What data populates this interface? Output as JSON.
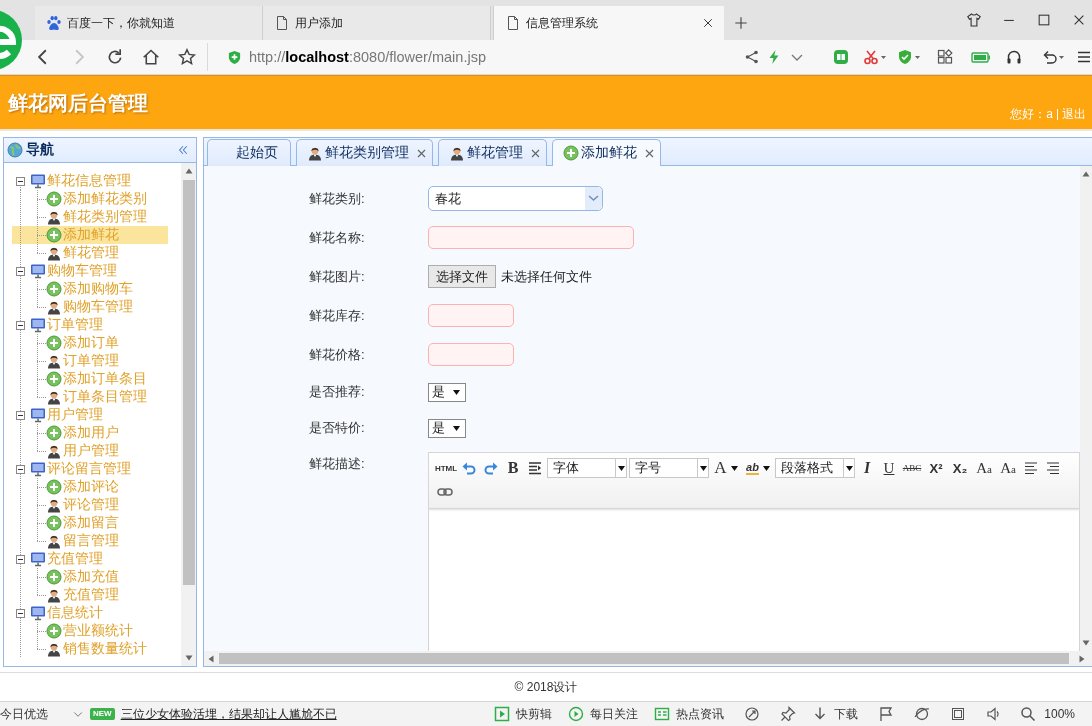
{
  "browser": {
    "tabs": [
      {
        "title": "百度一下，你就知道",
        "kind": "baidu",
        "selected": false
      },
      {
        "title": "用户添加",
        "kind": "page",
        "selected": false
      },
      {
        "title": "信息管理系统",
        "kind": "page",
        "selected": true
      }
    ],
    "nav_buttons": [
      {
        "kind": "back",
        "disabled": false
      },
      {
        "kind": "forward",
        "disabled": true
      },
      {
        "kind": "reload",
        "disabled": false
      },
      {
        "kind": "home",
        "disabled": false
      },
      {
        "kind": "bookmark",
        "disabled": false
      }
    ],
    "url": "http://**localhost**:8080/flower/main.jsp"
  },
  "header": {
    "title": "鲜花网后台管理",
    "greeting": "您好：a",
    "logout": "退出"
  },
  "sidebar": {
    "title": "导航",
    "groups": [
      {
        "label": "鲜花信息管理",
        "expanded": true,
        "selected": false,
        "children": [
          {
            "label": "添加鲜花类别",
            "kind": "add",
            "selected": false
          },
          {
            "label": "鲜花类别管理",
            "kind": "manage",
            "selected": false
          },
          {
            "label": "添加鲜花",
            "kind": "add",
            "selected": true
          },
          {
            "label": "鲜花管理",
            "kind": "manage",
            "selected": false
          }
        ]
      },
      {
        "label": "购物车管理",
        "expanded": true,
        "selected": false,
        "children": [
          {
            "label": "添加购物车",
            "kind": "add",
            "selected": false
          },
          {
            "label": "购物车管理",
            "kind": "manage",
            "selected": false
          }
        ]
      },
      {
        "label": "订单管理",
        "expanded": true,
        "selected": false,
        "children": [
          {
            "label": "添加订单",
            "kind": "add",
            "selected": false
          },
          {
            "label": "订单管理",
            "kind": "manage",
            "selected": false
          },
          {
            "label": "添加订单条目",
            "kind": "add",
            "selected": false
          },
          {
            "label": "订单条目管理",
            "kind": "manage",
            "selected": false
          }
        ]
      },
      {
        "label": "用户管理",
        "expanded": true,
        "selected": false,
        "children": [
          {
            "label": "添加用户",
            "kind": "add",
            "selected": false
          },
          {
            "label": "用户管理",
            "kind": "manage",
            "selected": false
          }
        ]
      },
      {
        "label": "评论留言管理",
        "expanded": true,
        "selected": false,
        "children": [
          {
            "label": "添加评论",
            "kind": "add",
            "selected": false
          },
          {
            "label": "评论管理",
            "kind": "manage",
            "selected": false
          },
          {
            "label": "添加留言",
            "kind": "add",
            "selected": false
          },
          {
            "label": "留言管理",
            "kind": "manage",
            "selected": false
          }
        ]
      },
      {
        "label": "充值管理",
        "expanded": true,
        "selected": false,
        "children": [
          {
            "label": "添加充值",
            "kind": "add",
            "selected": false
          },
          {
            "label": "充值管理",
            "kind": "manage",
            "selected": false
          }
        ]
      },
      {
        "label": "信息统计",
        "expanded": true,
        "selected": false,
        "children": [
          {
            "label": "营业额统计",
            "kind": "add",
            "selected": false
          },
          {
            "label": "销售数量统计",
            "kind": "manage",
            "selected": false
          }
        ]
      }
    ]
  },
  "tabs": [
    {
      "label": "起始页",
      "kind": "home",
      "selected": false,
      "closable": false
    },
    {
      "label": "鲜花类别管理",
      "kind": "manage",
      "selected": false,
      "closable": true
    },
    {
      "label": "鲜花管理",
      "kind": "manage",
      "selected": false,
      "closable": true
    },
    {
      "label": "添加鲜花",
      "kind": "add",
      "selected": true,
      "closable": true
    }
  ],
  "form": {
    "fields": [
      {
        "label": "鲜花类别:",
        "kind": "combo",
        "value": "春花"
      },
      {
        "label": "鲜花名称:",
        "kind": "text",
        "invalid": true
      },
      {
        "label": "鲜花图片:",
        "kind": "file",
        "button": "选择文件",
        "value": "未选择任何文件"
      },
      {
        "label": "鲜花库存:",
        "kind": "number",
        "invalid": true
      },
      {
        "label": "鲜花价格:",
        "kind": "number",
        "invalid": true
      },
      {
        "label": "是否推荐:",
        "kind": "select",
        "value": "是"
      },
      {
        "label": "是否特价:",
        "kind": "select",
        "value": "是"
      },
      {
        "label": "鲜花描述:",
        "kind": "editor",
        "toolbar_rows": [
          [
            {
              "kind": "source",
              "label": "HTML"
            },
            {
              "kind": "undo"
            },
            {
              "kind": "redo"
            },
            {
              "kind": "bold",
              "label": "B"
            },
            {
              "kind": "indent"
            },
            {
              "kind": "dropdown",
              "label": "字体"
            },
            {
              "kind": "dropdown",
              "label": "字号"
            },
            {
              "kind": "forecolor",
              "label": "A"
            },
            {
              "kind": "highlight",
              "label": "ab"
            },
            {
              "kind": "dropdown",
              "label": "段落格式"
            },
            {
              "kind": "italic",
              "label": "I"
            },
            {
              "kind": "underline",
              "label": "U"
            },
            {
              "kind": "strike",
              "label": "ABC"
            },
            {
              "kind": "superscript",
              "label": "X²"
            },
            {
              "kind": "subscript",
              "label": "X₂"
            },
            {
              "kind": "case",
              "label": "Aa"
            },
            {
              "kind": "case",
              "label": "Aa"
            },
            {
              "kind": "alignleft"
            },
            {
              "kind": "alignright"
            }
          ],
          [
            {
              "kind": "link"
            }
          ]
        ]
      }
    ]
  },
  "footer": {
    "text": "© 2018设计"
  },
  "status_bar": {
    "label": "今日优选",
    "badge": "NEW",
    "headline": "三位少女体验活埋，结果却让人尴尬不已",
    "items": [
      {
        "kind": "clip",
        "label": "快剪辑"
      },
      {
        "kind": "follow",
        "label": "每日关注"
      },
      {
        "kind": "news",
        "label": "热点资讯"
      },
      {
        "kind": "download",
        "label": "下载"
      }
    ],
    "zoom": "100%"
  }
}
